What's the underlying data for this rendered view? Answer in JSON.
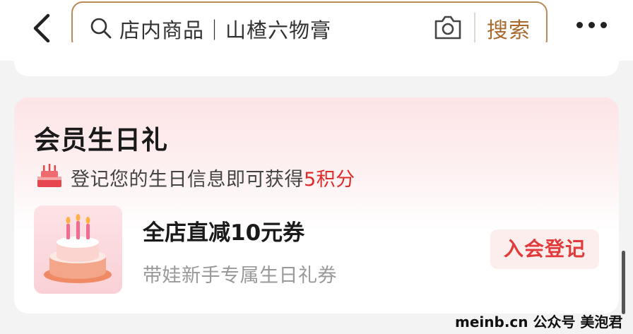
{
  "header": {
    "search_placeholder": "店内商品｜山楂六物膏",
    "search_button": "搜索"
  },
  "birthday_card": {
    "title": "会员生日礼",
    "subtitle_prefix": "登记您的生日信息即可获得",
    "subtitle_points": "5积分",
    "coupon_title": "全店直减10元券",
    "coupon_desc": "带娃新手专属生日礼券",
    "join_button": "入会登记"
  },
  "watermark": "meinb.cn 公众号 美泡君",
  "colors": {
    "accent_brown": "#a86a2f",
    "highlight_red": "#e02b2b",
    "button_bg": "#fdeeee"
  },
  "icons": [
    "back-arrow-icon",
    "search-icon",
    "camera-icon",
    "more-dots-icon",
    "cake-icon"
  ]
}
